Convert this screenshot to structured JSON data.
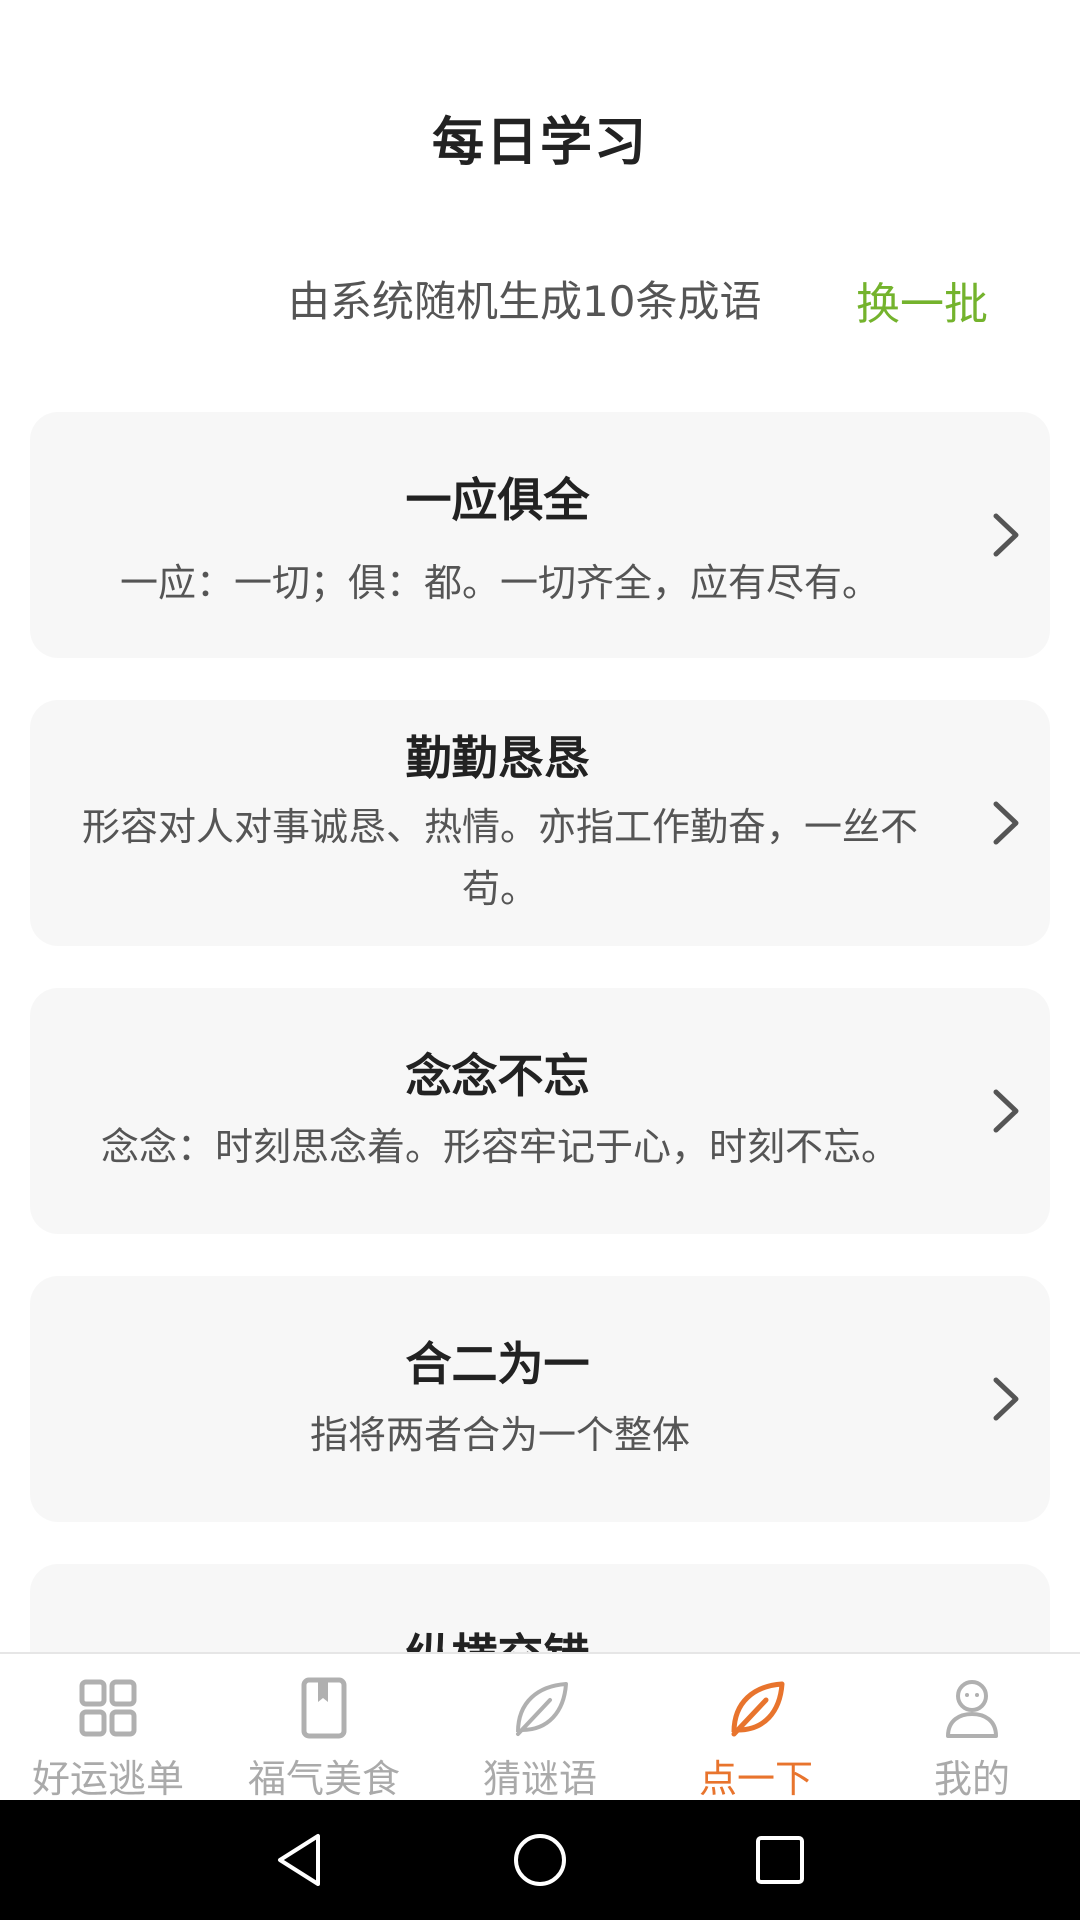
{
  "header": {
    "title": "每日学习",
    "subtitle": "由系统随机生成10条成语",
    "refresh_label": "换一批"
  },
  "idioms": [
    {
      "title": "一应俱全",
      "desc": "一应：一切；俱：都。一切齐全，应有尽有。"
    },
    {
      "title": "勤勤恳恳",
      "desc": "形容对人对事诚恳、热情。亦指工作勤奋，一丝不苟。"
    },
    {
      "title": "念念不忘",
      "desc": "念念：时刻思念着。形容牢记于心，时刻不忘。"
    },
    {
      "title": "合二为一",
      "desc": "指将两者合为一个整体"
    },
    {
      "title": "纵横交错",
      "desc": ""
    }
  ],
  "tabs": [
    {
      "label": "好运逃单",
      "icon": "grid-icon"
    },
    {
      "label": "福气美食",
      "icon": "book-icon"
    },
    {
      "label": "猜谜语",
      "icon": "leaf-icon"
    },
    {
      "label": "点一下",
      "icon": "leaf-icon",
      "active": true
    },
    {
      "label": "我的",
      "icon": "person-icon"
    }
  ],
  "colors": {
    "accent_green": "#74b32d",
    "accent_orange": "#e8742d",
    "tab_inactive": "#aaaaaa"
  }
}
